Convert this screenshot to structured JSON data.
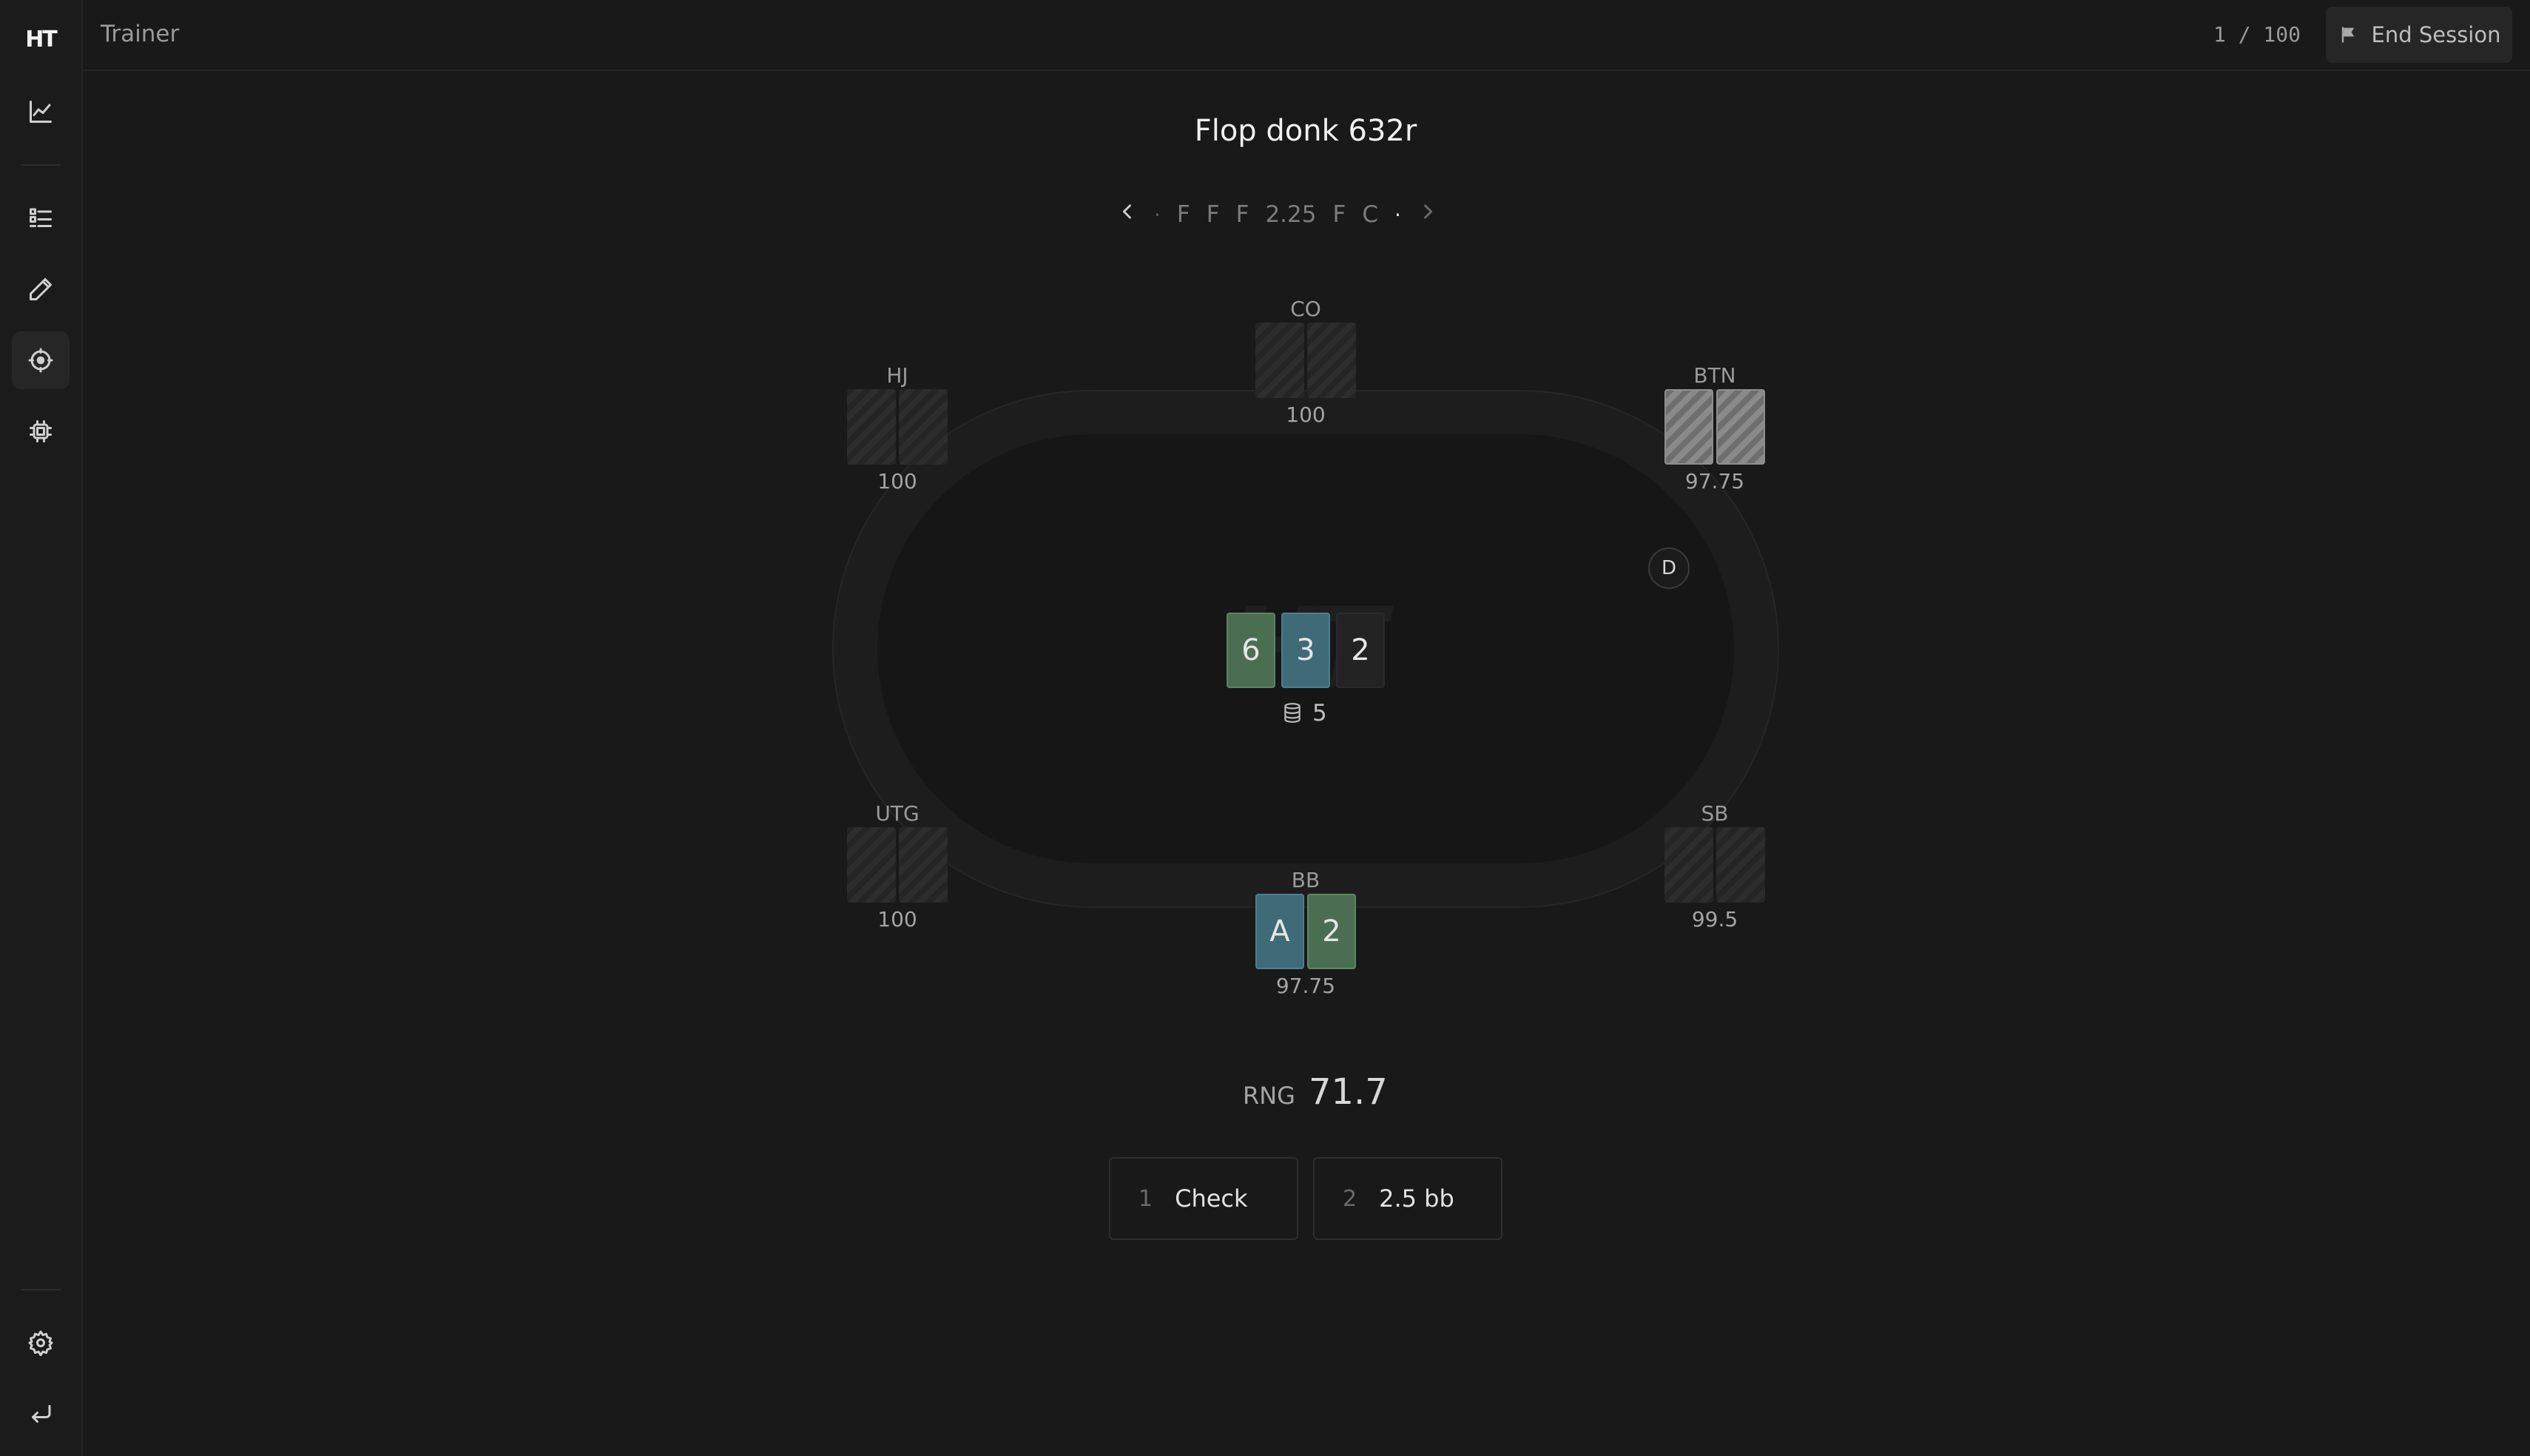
{
  "sidebar": {
    "logo": "HT",
    "items": [
      {
        "name": "chart-icon"
      },
      {
        "name": "checklist-icon"
      },
      {
        "name": "pencil-icon"
      },
      {
        "name": "target-icon",
        "active": true
      },
      {
        "name": "chip-icon"
      }
    ],
    "bottom": [
      {
        "name": "gear-icon"
      },
      {
        "name": "return-icon"
      }
    ]
  },
  "header": {
    "title": "Trainer",
    "progress": "1 / 100",
    "end_session_label": "End Session"
  },
  "spot": {
    "title": "Flop donk 632r"
  },
  "action_history": {
    "items": [
      "F",
      "F",
      "F",
      "2.25",
      "F",
      "C"
    ]
  },
  "seats": {
    "co": {
      "label": "CO",
      "stack": "100"
    },
    "hj": {
      "label": "HJ",
      "stack": "100"
    },
    "btn": {
      "label": "BTN",
      "stack": "97.75"
    },
    "utg": {
      "label": "UTG",
      "stack": "100"
    },
    "sb": {
      "label": "SB",
      "stack": "99.5"
    },
    "bb": {
      "label": "BB",
      "stack": "97.75",
      "cards": [
        "A",
        "2"
      ]
    }
  },
  "board": {
    "cards": [
      "6",
      "3",
      "2"
    ],
    "pot": "5"
  },
  "dealer_button": "D",
  "watermark": "HT",
  "rng": {
    "label": "RNG",
    "value": "71.7"
  },
  "answers": [
    {
      "key": "1",
      "label": "Check"
    },
    {
      "key": "2",
      "label": "2.5 bb"
    }
  ],
  "colors": {
    "background": "#191919",
    "suit_green": "#4b6e52",
    "suit_blue": "#3f6a78",
    "dealer_border": "#3a3a3a"
  }
}
